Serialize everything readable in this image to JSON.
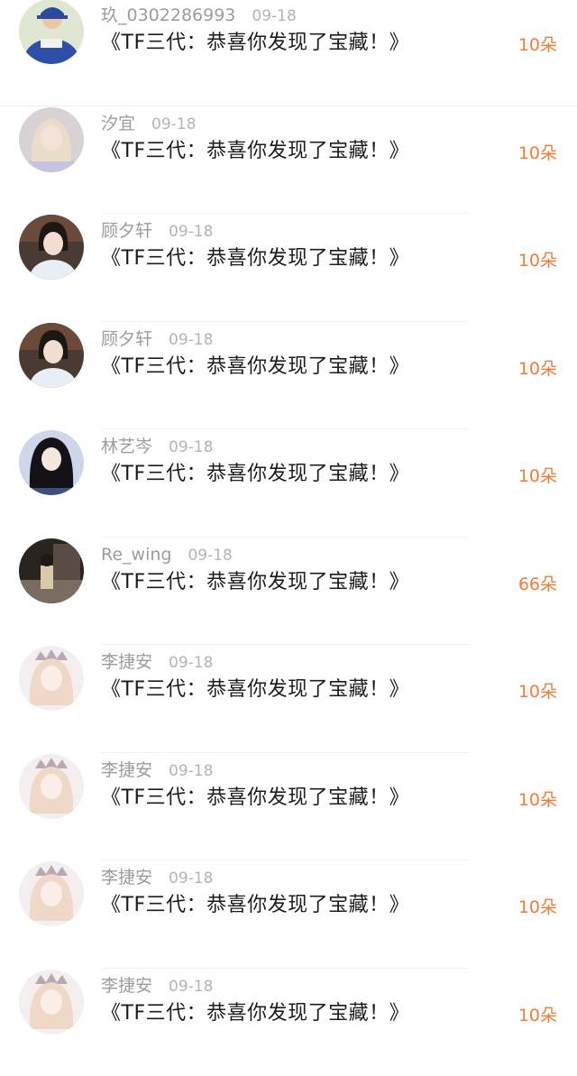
{
  "colors": {
    "amount": "#f07c38",
    "username": "#9c9c9c",
    "title": "#1c1c1c"
  },
  "gifts": [
    {
      "username": "玖_0302286993",
      "date": "09-18",
      "title": "《TF三代：恭喜你发现了宝藏！》",
      "amount": "10朵",
      "avatar": "boy-blue-jacket"
    },
    {
      "username": "汐宜",
      "date": "09-18",
      "title": "《TF三代：恭喜你发现了宝藏！》",
      "amount": "10朵",
      "avatar": "girl-light-hair"
    },
    {
      "username": "顾夕轩",
      "date": "09-18",
      "title": "《TF三代：恭喜你发现了宝藏！》",
      "amount": "10朵",
      "avatar": "girl-dark-hair"
    },
    {
      "username": "顾夕轩",
      "date": "09-18",
      "title": "《TF三代：恭喜你发现了宝藏！》",
      "amount": "10朵",
      "avatar": "girl-dark-hair"
    },
    {
      "username": "林艺岑",
      "date": "09-18",
      "title": "《TF三代：恭喜你发现了宝藏！》",
      "amount": "10朵",
      "avatar": "girl-long-hair"
    },
    {
      "username": "Re_wing",
      "date": "09-18",
      "title": "《TF三代：恭喜你发现了宝藏！》",
      "amount": "66朵",
      "avatar": "person-street"
    },
    {
      "username": "李捷安",
      "date": "09-18",
      "title": "《TF三代：恭喜你发现了宝藏！》",
      "amount": "10朵",
      "avatar": "girl-crown"
    },
    {
      "username": "李捷安",
      "date": "09-18",
      "title": "《TF三代：恭喜你发现了宝藏！》",
      "amount": "10朵",
      "avatar": "girl-crown"
    },
    {
      "username": "李捷安",
      "date": "09-18",
      "title": "《TF三代：恭喜你发现了宝藏！》",
      "amount": "10朵",
      "avatar": "girl-crown"
    },
    {
      "username": "李捷安",
      "date": "09-18",
      "title": "《TF三代：恭喜你发现了宝藏！》",
      "amount": "10朵",
      "avatar": "girl-crown"
    }
  ]
}
